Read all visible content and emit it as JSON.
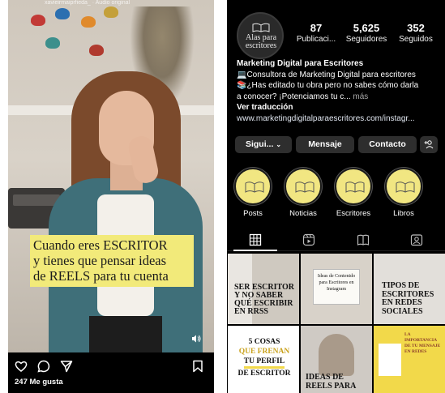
{
  "reel": {
    "handle": "xavieirmaiprfieda_ · Audio original",
    "caption_lines": [
      "Cuando eres ESCRITOR",
      "y tienes que pensar ideas",
      "de REELS para tu cuenta"
    ],
    "likes": "247 Me gusta",
    "icons": [
      "heart-icon",
      "comment-icon",
      "share-icon",
      "bookmark-icon",
      "sound-icon"
    ]
  },
  "profile": {
    "avatar_text_line1": "Alas para",
    "avatar_text_line2": "escritores",
    "stats": [
      {
        "num": "87",
        "label": "Publicaci..."
      },
      {
        "num": "5,625",
        "label": "Seguidores"
      },
      {
        "num": "352",
        "label": "Seguidos"
      }
    ],
    "bio": {
      "name": "Marketing Digital para Escritores",
      "line1": "💻Consultora de Marketing Digital para escritores",
      "line2": "📚¿Has editado tu obra pero no sabes cómo darla",
      "line3": "a conocer? ¡Potenciamos tu c...",
      "more": " más",
      "translate": "Ver traducción",
      "link": "www.marketingdigitalparaescritores.com/instagr..."
    },
    "buttons": {
      "following": "Sigui...",
      "message": "Mensaje",
      "contact": "Contacto"
    },
    "highlights": [
      "Posts",
      "Noticias",
      "Escritores",
      "Libros"
    ],
    "tabs": [
      "grid-icon",
      "reels-icon",
      "guides-icon",
      "tagged-icon"
    ],
    "tiles": {
      "t1": [
        "SER ESCRITOR",
        "Y NO SABER",
        "QUÉ ESCRIBIR",
        "EN RRSS"
      ],
      "t2": [
        "Ideas de Contenido",
        "para Escritores en",
        "Instagram"
      ],
      "t3": [
        "TIPOS DE",
        "ESCRITORES",
        "EN REDES",
        "SOCIALES"
      ],
      "t4": [
        "5 COSAS",
        "QUE FRENAN",
        "TU PERFIL",
        "DE ESCRITOR"
      ],
      "t5": [
        "IDEAS DE",
        "REELS PARA"
      ],
      "t6": [
        "LA",
        "IMPORTANCIA",
        "DE TU MENSAJE",
        "EN REDES"
      ]
    },
    "colors": {
      "highlight": "#f1e682",
      "tile_accent": "#f2d94a"
    }
  }
}
